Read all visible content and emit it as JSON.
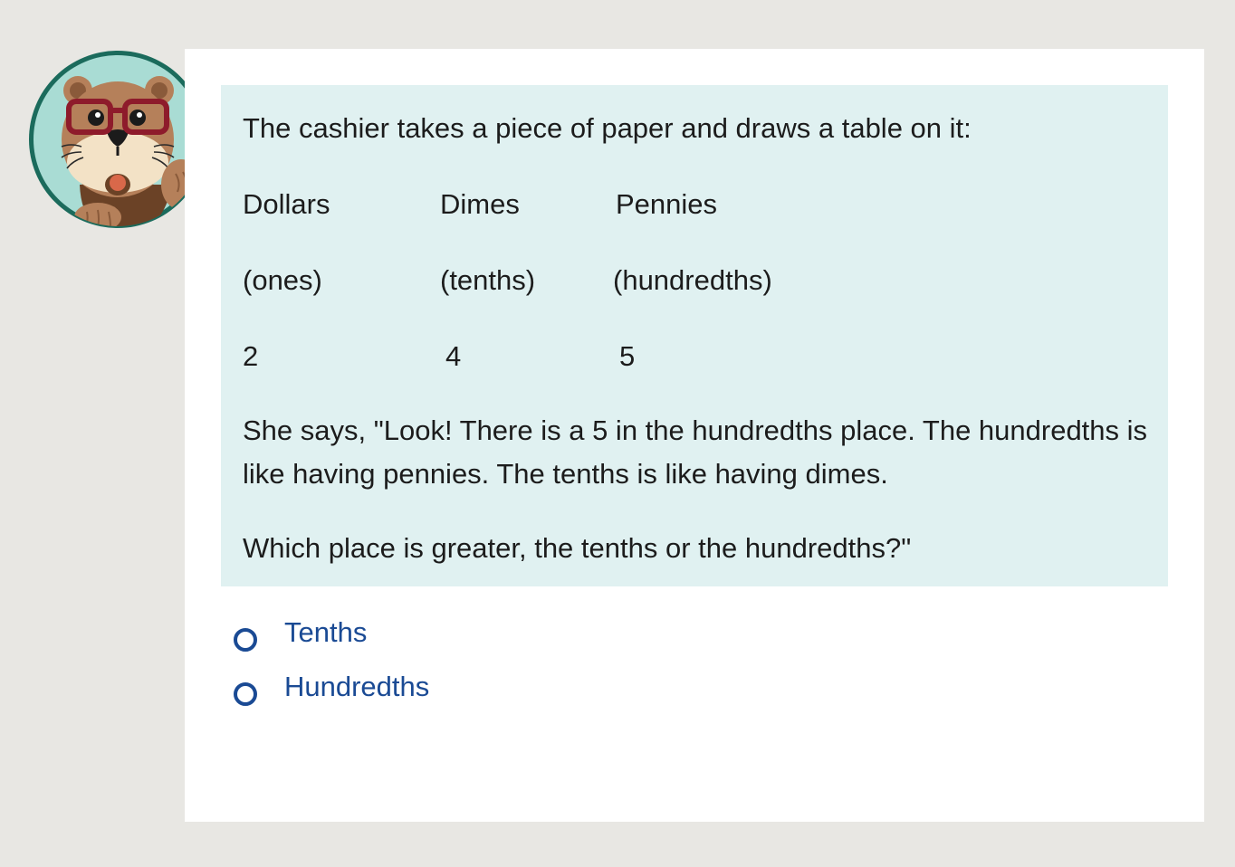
{
  "avatar": {
    "icon": "otter-with-glasses-icon",
    "colors": {
      "ring": "#1b6b5c",
      "bg": "#a9dcd4"
    }
  },
  "prompt": {
    "intro": "The cashier takes a piece of paper and draws a table on it:",
    "table": {
      "headers": [
        "Dollars",
        "Dimes",
        "Pennies"
      ],
      "subheaders": [
        "(ones)",
        "(tenths)",
        "(hundredths)"
      ],
      "values": [
        "2",
        "4",
        "5"
      ]
    },
    "statement": "She says, \"Look! There is a 5 in the hundredths place. The hundredths is like having pennies. The tenths is like having dimes.",
    "question": "Which place is greater, the tenths or the hundredths?\""
  },
  "options": [
    {
      "label": "Tenths",
      "selected": false
    },
    {
      "label": "Hundredths",
      "selected": false
    }
  ],
  "colors": {
    "prompt_bg": "#e0f1f1",
    "option_text": "#1a4a94",
    "page_bg": "#e8e7e3"
  }
}
